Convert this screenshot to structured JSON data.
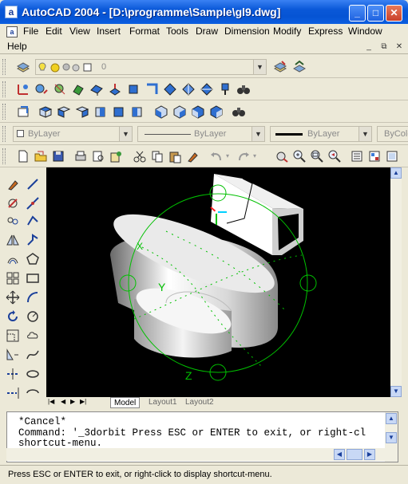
{
  "window": {
    "app_icon": "a",
    "title": "AutoCAD 2004 - [D:\\programme\\Sample\\gl9.dwg]",
    "buttons": {
      "minimize": "_",
      "maximize": "□",
      "close": "✕"
    }
  },
  "menu": {
    "items": [
      "File",
      "Edit",
      "View",
      "Insert",
      "Format",
      "Tools",
      "Draw",
      "Dimension",
      "Modify",
      "Express",
      "Window",
      "Help"
    ],
    "doc_buttons": {
      "minimize": "_",
      "restore": "⧉",
      "close": "✕"
    }
  },
  "layers_toolbar": {
    "layer_value": "0"
  },
  "properties_toolbar": {
    "color": "ByLayer",
    "linetype": "ByLayer",
    "lineweight": "ByLayer",
    "plotstyle": "ByColor"
  },
  "viewport": {
    "background": "#000000",
    "orbit_color": "#00c000",
    "axis_labels": {
      "x": "X",
      "y": "Y",
      "z": "Z"
    }
  },
  "layout_tabs": [
    "Model",
    "Layout1",
    "Layout2"
  ],
  "command": {
    "lines": [
      "*Cancel*",
      "Command: '_3dorbit Press ESC or ENTER to exit, or right-cl",
      "shortcut-menu."
    ]
  },
  "status": {
    "text": "Press ESC or ENTER to exit, or right-click to display shortcut-menu."
  }
}
